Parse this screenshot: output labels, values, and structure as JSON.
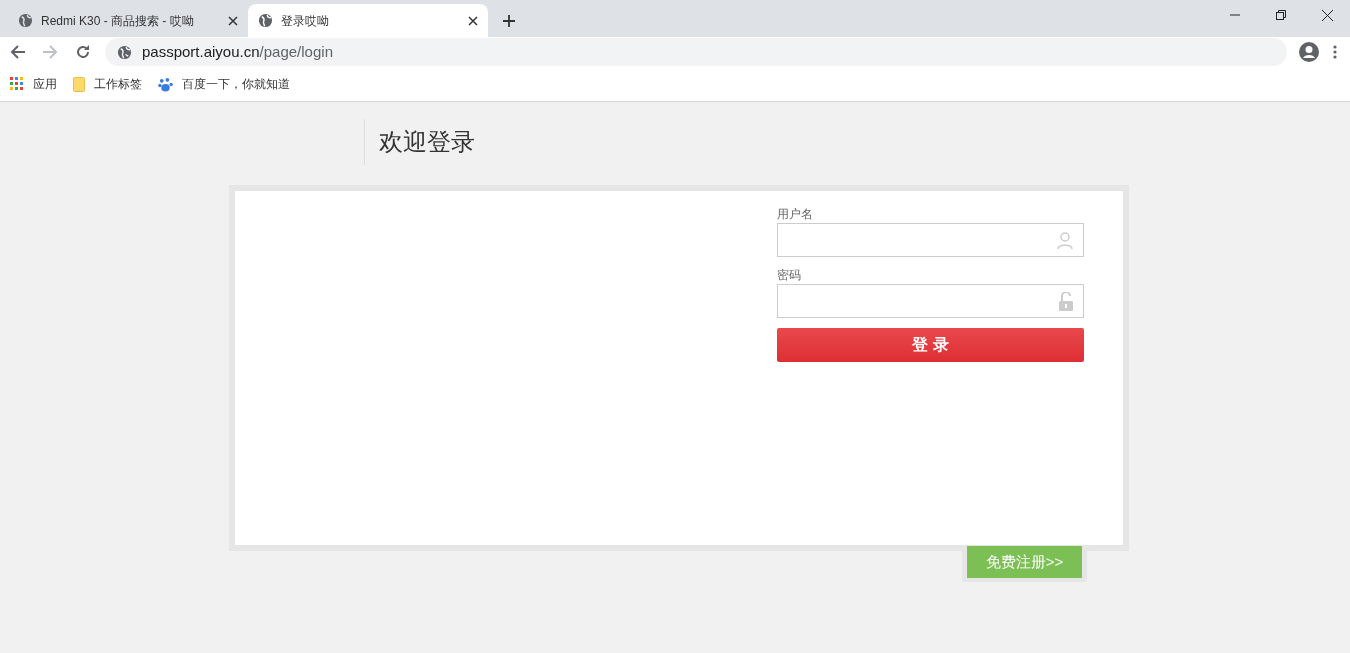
{
  "tabs": [
    {
      "title": "Redmi K30 - 商品搜索 - 哎呦",
      "selected": false
    },
    {
      "title": "登录哎呦",
      "selected": true
    }
  ],
  "address_bar": {
    "host": "passport.aiyou.cn",
    "path": "/page/login"
  },
  "bookmarks": [
    {
      "kind": "apps",
      "label": "应用"
    },
    {
      "kind": "folder",
      "label": "工作标签"
    },
    {
      "kind": "paw",
      "label": "百度一下，你就知道"
    }
  ],
  "page": {
    "heading": "欢迎登录",
    "fields": [
      {
        "label": "用户名",
        "kind": "user"
      },
      {
        "label": "密码",
        "kind": "lock"
      }
    ],
    "login_button": "登 录",
    "register_button": "免费注册>>"
  }
}
